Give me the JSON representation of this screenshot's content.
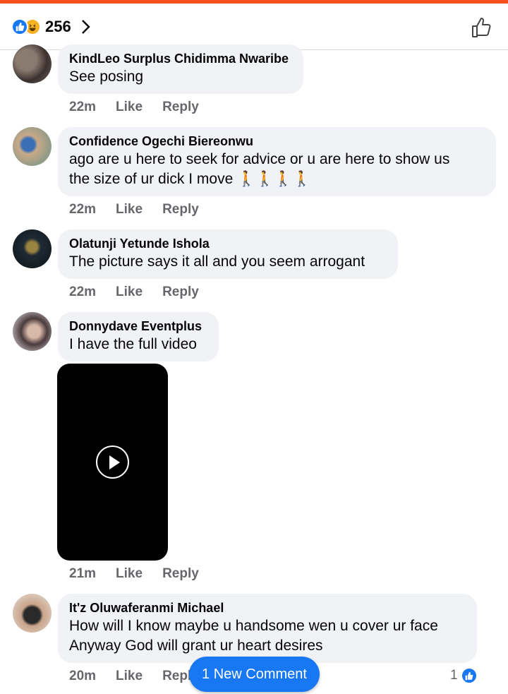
{
  "header": {
    "reaction_count": "256",
    "reaction_icons": [
      "like-icon",
      "haha-icon"
    ],
    "like_icon": "thumbs-up-outline-icon"
  },
  "colors": {
    "accent": "#1877f2",
    "top_bar": "#f4511e",
    "bubble": "#f0f2f5",
    "meta_text": "#65676b"
  },
  "comments": [
    {
      "name": "KindLeo Surplus Chidimma Nwaribe",
      "text": "See posing",
      "time": "22m",
      "like": "Like",
      "reply": "Reply"
    },
    {
      "name": "Confidence Ogechi Biereonwu",
      "text_line1": "ago are u here to seek for advice or u are here to show us",
      "text_line2": "the size of ur dick I move 🚶🚶🚶🚶",
      "time": "22m",
      "like": "Like",
      "reply": "Reply"
    },
    {
      "name": "Olatunji Yetunde Ishola",
      "text": "The picture says it all and you seem arrogant",
      "time": "22m",
      "like": "Like",
      "reply": "Reply"
    },
    {
      "name": "Donnydave Eventplus",
      "text": "I have the full video",
      "time": "21m",
      "like": "Like",
      "reply": "Reply",
      "attachment": "video"
    },
    {
      "name": "It'z Oluwaferanmi Michael",
      "text_line1": "How will I know maybe u handsome wen u cover ur face",
      "text_line2": "Anyway God will grant ur heart desires",
      "time": "20m",
      "like": "Like",
      "reply": "Reply",
      "reaction_count": "1"
    }
  ],
  "new_comment_label": "1 New Comment"
}
